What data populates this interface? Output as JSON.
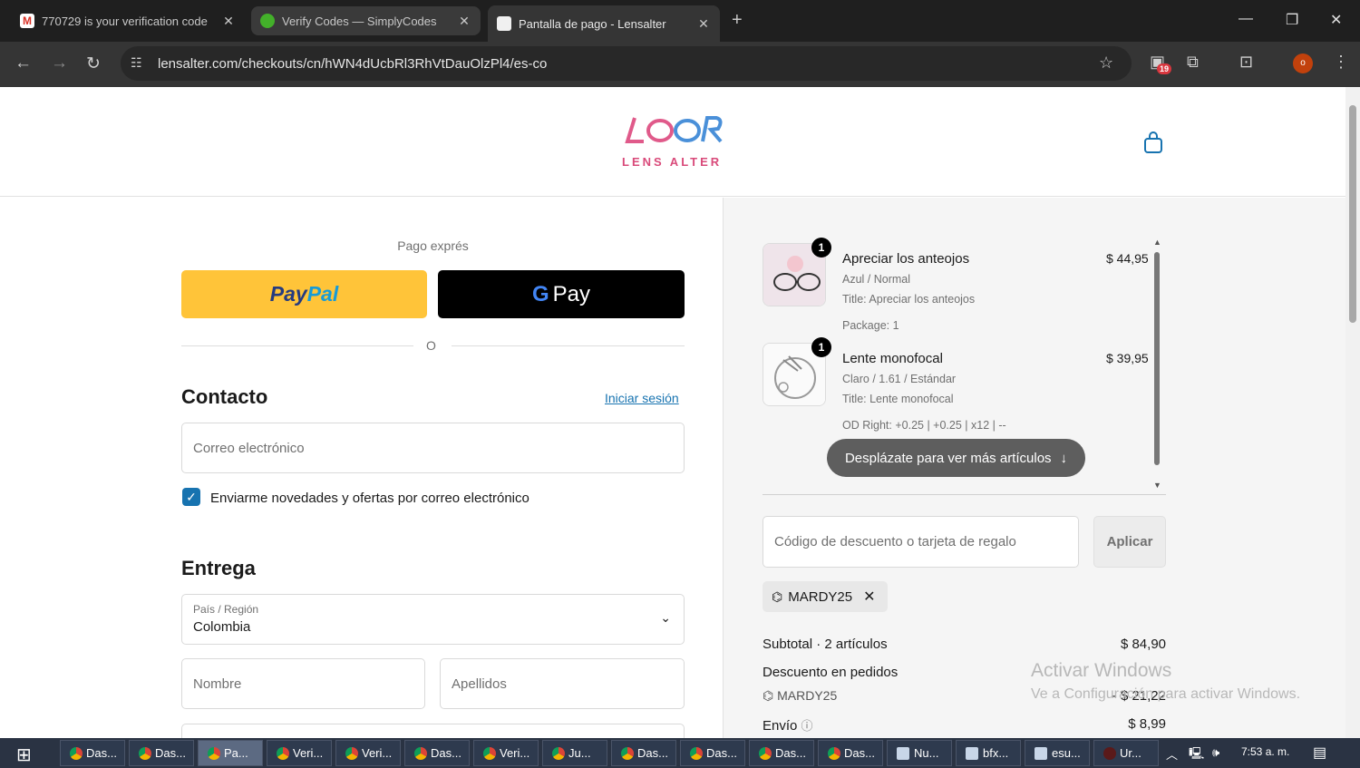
{
  "browser": {
    "tabs": [
      {
        "title": "770729 is your verification code",
        "favicon": "gmail"
      },
      {
        "title": "Verify Codes — SimplyCodes",
        "favicon": "simplycodes"
      },
      {
        "title": "Pantalla de pago - Lensalter",
        "favicon": "lensalter"
      }
    ],
    "url": "lensalter.com/checkouts/cn/hWN4dUcbRl3RhVtDauOlzPl4/es-co",
    "extension_badge": "19",
    "profile_initial": "o"
  },
  "header": {
    "brand": "LENS ALTER"
  },
  "checkout": {
    "express_label": "Pago exprés",
    "paypal_label_1": "Pay",
    "paypal_label_2": "Pal",
    "gpay_g": "G",
    "gpay_label": "Pay",
    "or_label": "O",
    "contact_title": "Contacto",
    "login_link": "Iniciar sesión",
    "email_placeholder": "Correo electrónico",
    "newsletter_label": "Enviarme novedades y ofertas por correo electrónico",
    "delivery_title": "Entrega",
    "country_label": "País / Región",
    "country_value": "Colombia",
    "first_name_placeholder": "Nombre",
    "last_name_placeholder": "Apellidos"
  },
  "summary": {
    "items": [
      {
        "qty": "1",
        "name": "Apreciar los anteojos",
        "price": "$ 44,95",
        "variant": "Azul / Normal",
        "line1": "Title: Apreciar los anteojos",
        "line2": "Package: 1"
      },
      {
        "qty": "1",
        "name": "Lente monofocal",
        "price": "$ 39,95",
        "variant": "Claro / 1.61 / Estándar",
        "line1": "Title: Lente monofocal",
        "line2": "OD Right: +0.25 | +0.25 | x12 | --"
      }
    ],
    "scroll_hint": "Desplázate para ver más artículos",
    "discount_placeholder": "Código de descuento o tarjeta de regalo",
    "apply_label": "Aplicar",
    "applied_code": "MARDY25",
    "subtotal_label": "Subtotal · 2 artículos",
    "subtotal_value": "$ 84,90",
    "order_discount_label": "Descuento en pedidos",
    "discount_code": "MARDY25",
    "discount_value": "- $ 21,22",
    "shipping_label": "Envío",
    "shipping_value": "$ 8,99"
  },
  "watermark": {
    "line1": "Activar Windows",
    "line2": "Ve a Configuración para activar Windows."
  },
  "taskbar": {
    "items": [
      "Das...",
      "Das...",
      "Pa...",
      "Veri...",
      "Veri...",
      "Das...",
      "Veri...",
      "Ju...",
      "Das...",
      "Das...",
      "Das...",
      "Das...",
      "Nu...",
      "bfx...",
      "esu...",
      "Ur..."
    ],
    "clock": "7:53 a. m."
  }
}
